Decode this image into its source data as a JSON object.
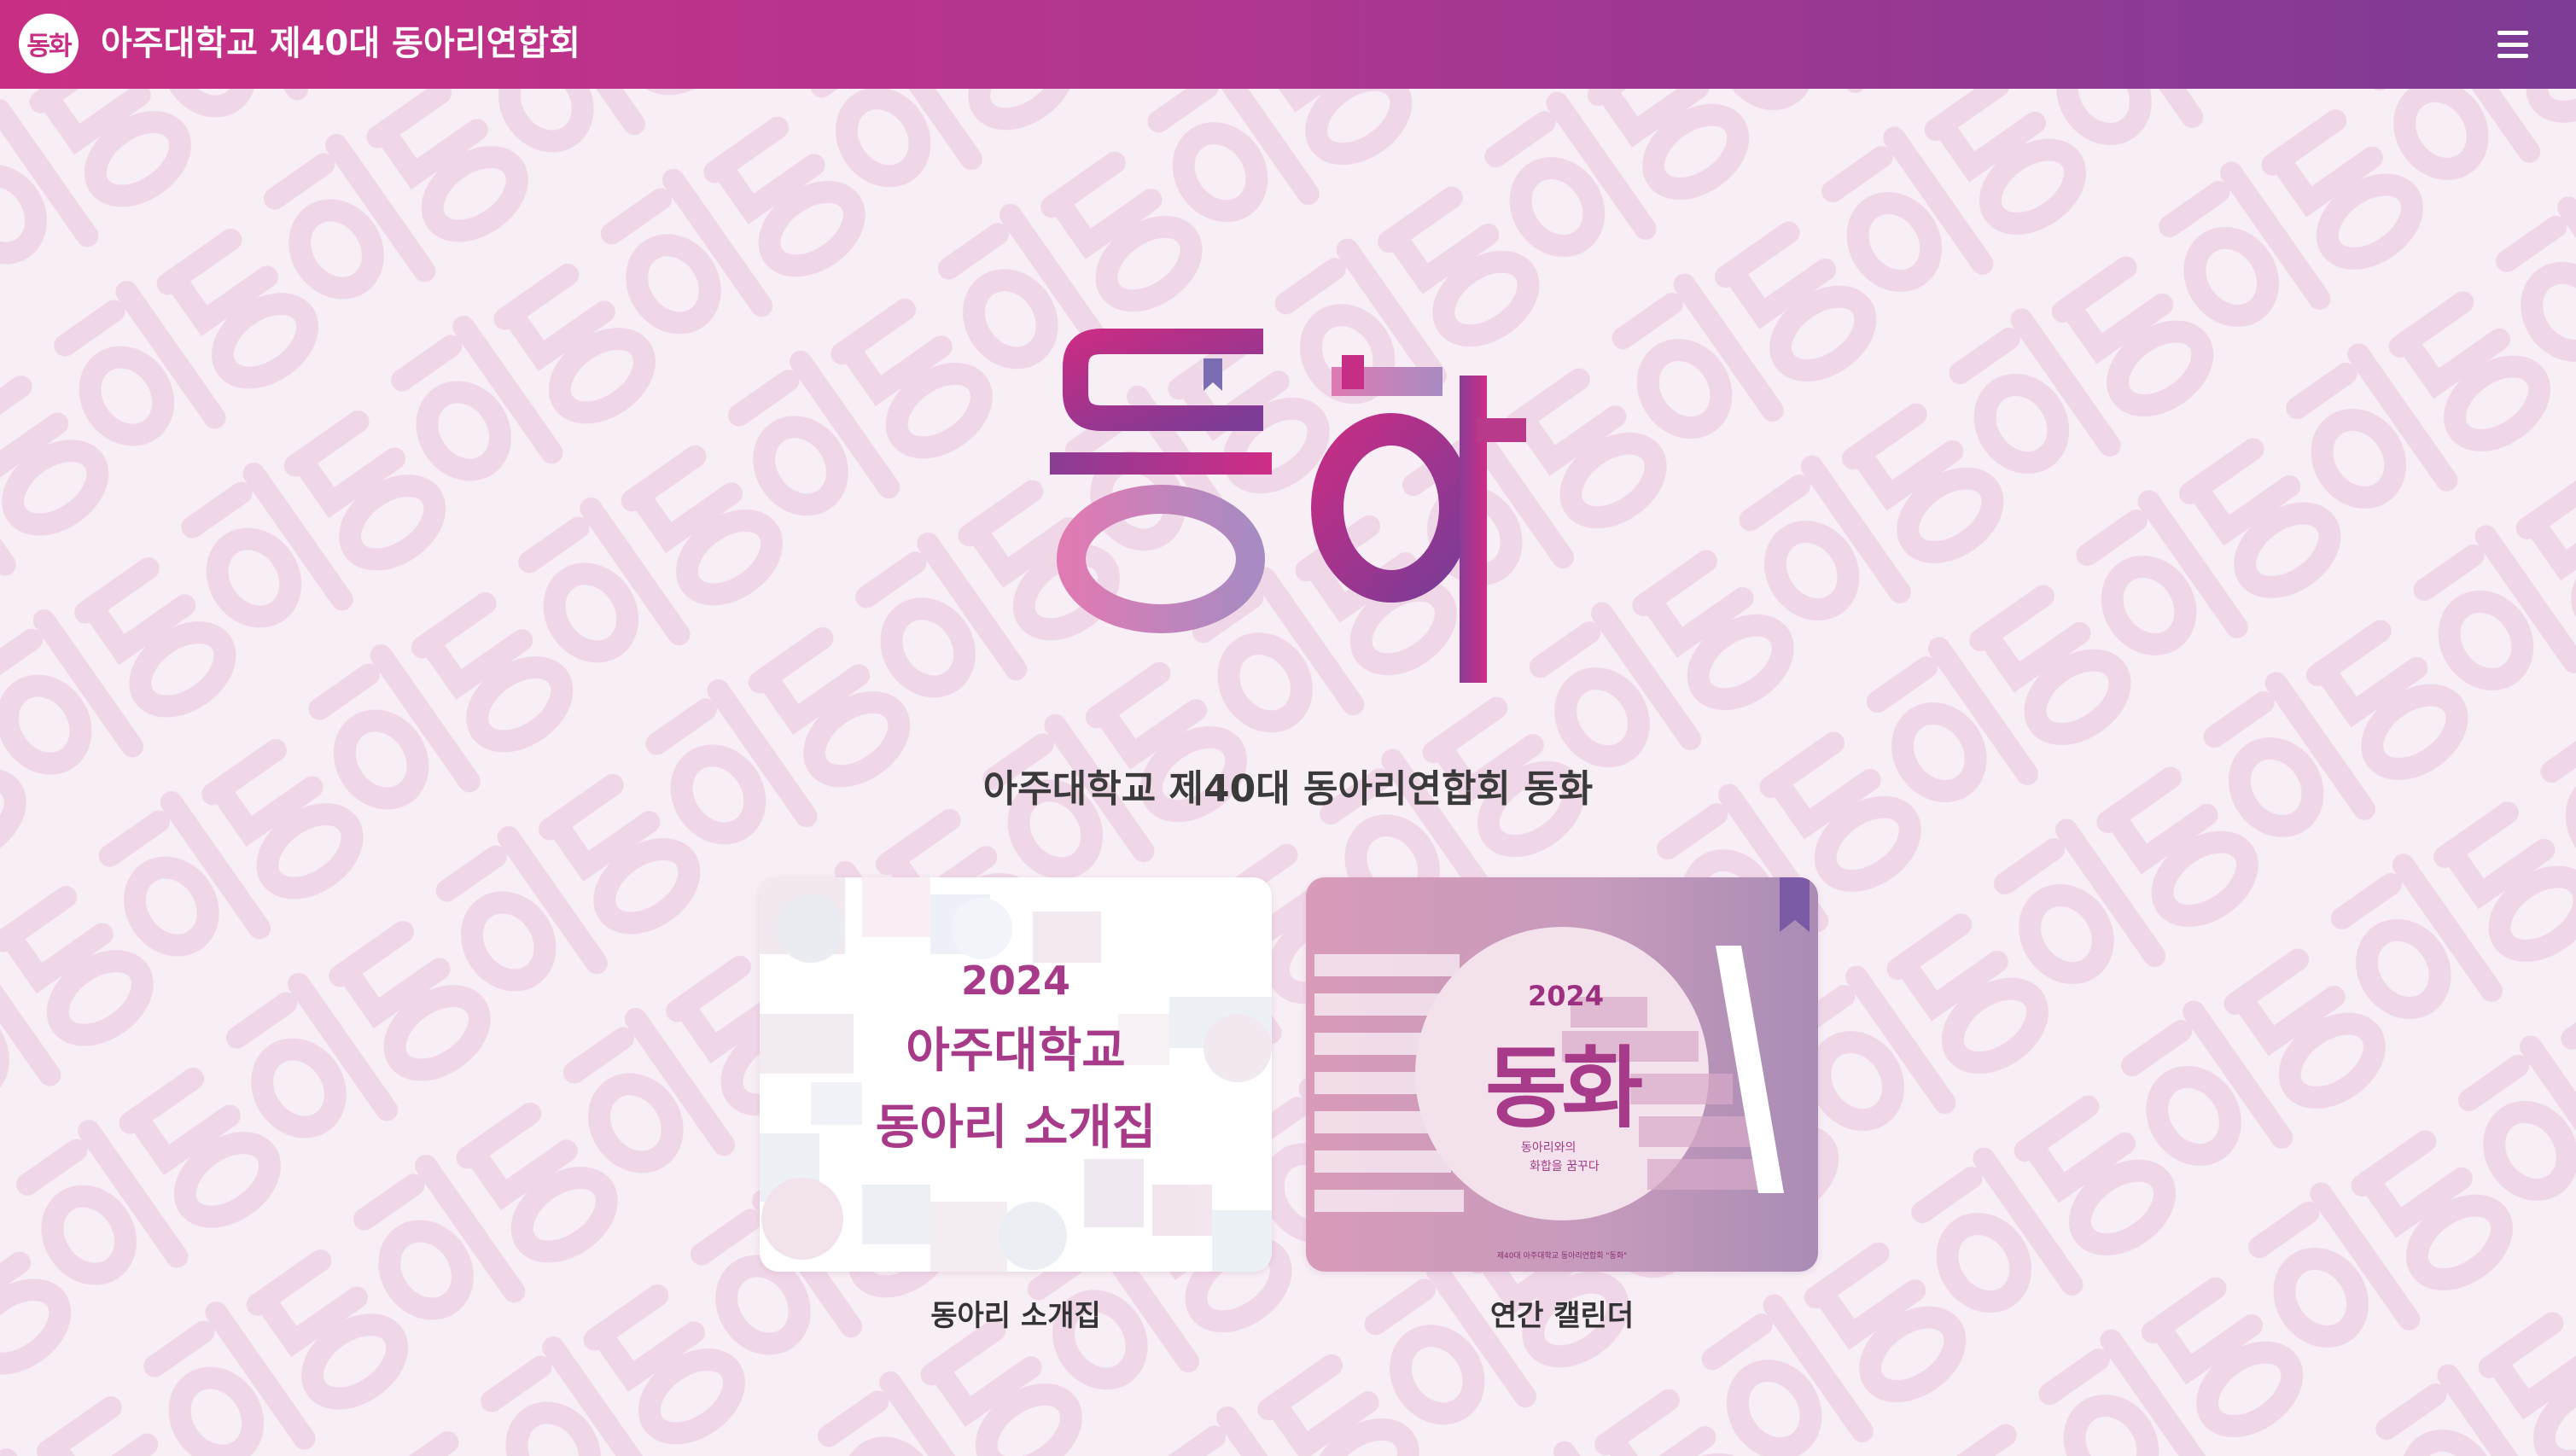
{
  "header": {
    "logo_text": "동화",
    "title": "아주대학교 제40대 동아리연합회",
    "menu_icon": "hamburger-menu-icon"
  },
  "hero": {
    "logo_text": "동화",
    "title": "아주대학교 제40대 동아리연합회 동화"
  },
  "cards": [
    {
      "year": "2024",
      "line1": "아주대학교",
      "line2": "동아리 소개집",
      "label": "동아리 소개집"
    },
    {
      "year": "2024",
      "word": "동화",
      "tagline_1": "동아리와의",
      "tagline_2": "화합을 꿈꾸다",
      "footer": "제40대 아주대학교 동아리연합회 \"동화\"",
      "label": "연간 캘린더"
    }
  ],
  "colors": {
    "header_start": "#c82f83",
    "header_end": "#7d3b95",
    "accent": "#a83a8a",
    "background": "#f8eef5"
  }
}
